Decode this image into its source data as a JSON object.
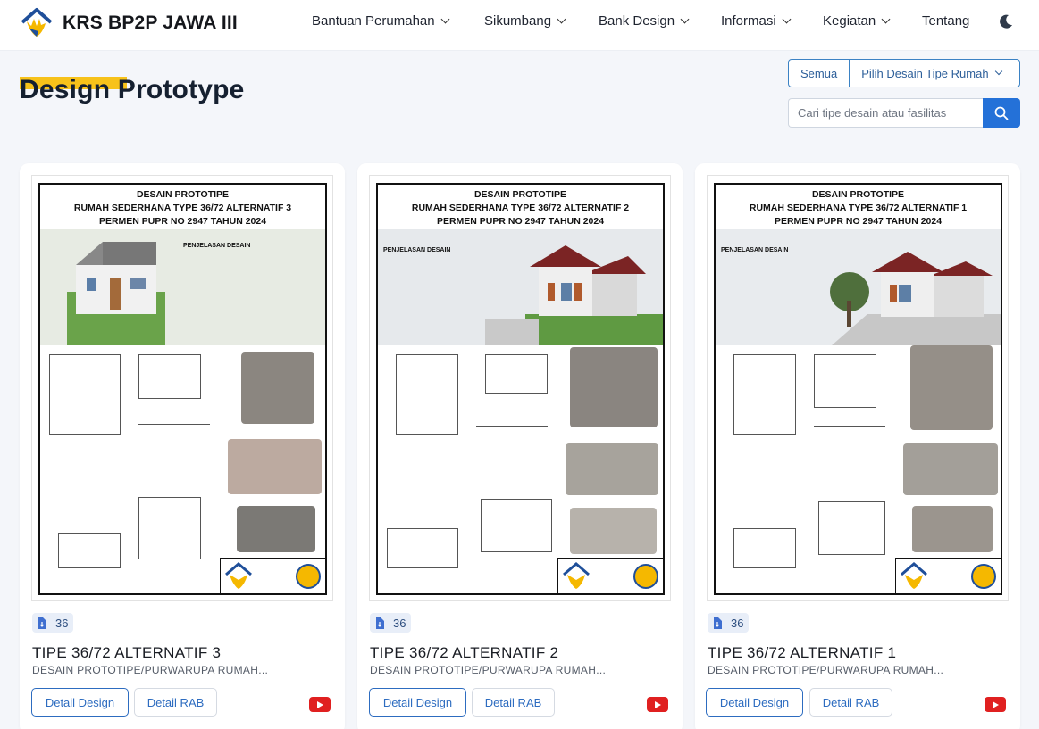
{
  "header": {
    "brand_title": "KRS BP2P JAWA III",
    "nav": [
      {
        "label": "Bantuan Perumahan",
        "has_dropdown": true
      },
      {
        "label": "Sikumbang",
        "has_dropdown": true
      },
      {
        "label": "Bank Design",
        "has_dropdown": true
      },
      {
        "label": "Informasi",
        "has_dropdown": true
      },
      {
        "label": "Kegiatan",
        "has_dropdown": true
      },
      {
        "label": "Tentang",
        "has_dropdown": false
      }
    ],
    "theme_toggle_icon": "moon-icon"
  },
  "page": {
    "title": "Design Prototype",
    "accent_color": "#f7c21a"
  },
  "filters": {
    "all_label": "Semua",
    "type_select_label": "Pilih Desain Tipe Rumah"
  },
  "search": {
    "placeholder": "Cari tipe desain atau fasilitas",
    "button_icon": "search-icon"
  },
  "cards": [
    {
      "poster_heading": [
        "DESAIN PROTOTIPE",
        "RUMAH SEDERHANA TYPE 36/72 ALTERNATIF 3",
        "PERMEN PUPR NO 2947 TAHUN 2024"
      ],
      "poster_section": "PENJELASAN DESAIN",
      "count": "36",
      "title": "TIPE 36/72 ALTERNATIF 3",
      "subtitle": "DESAIN PROTOTIPE/PURWARUPA RUMAH...",
      "detail_design_label": "Detail Design",
      "detail_rab_label": "Detail RAB"
    },
    {
      "poster_heading": [
        "DESAIN PROTOTIPE",
        "RUMAH SEDERHANA TYPE 36/72 ALTERNATIF 2",
        "PERMEN PUPR NO 2947 TAHUN 2024"
      ],
      "poster_section": "PENJELASAN DESAIN",
      "count": "36",
      "title": "TIPE 36/72 ALTERNATIF 2",
      "subtitle": "DESAIN PROTOTIPE/PURWARUPA RUMAH...",
      "detail_design_label": "Detail Design",
      "detail_rab_label": "Detail RAB"
    },
    {
      "poster_heading": [
        "DESAIN PROTOTIPE",
        "RUMAH SEDERHANA TYPE 36/72 ALTERNATIF 1",
        "PERMEN PUPR NO 2947 TAHUN 2024"
      ],
      "poster_section": "PENJELASAN DESAIN",
      "count": "36",
      "title": "TIPE 36/72 ALTERNATIF 1",
      "subtitle": "DESAIN PROTOTIPE/PURWARUPA RUMAH...",
      "detail_design_label": "Detail Design",
      "detail_rab_label": "Detail RAB"
    }
  ]
}
